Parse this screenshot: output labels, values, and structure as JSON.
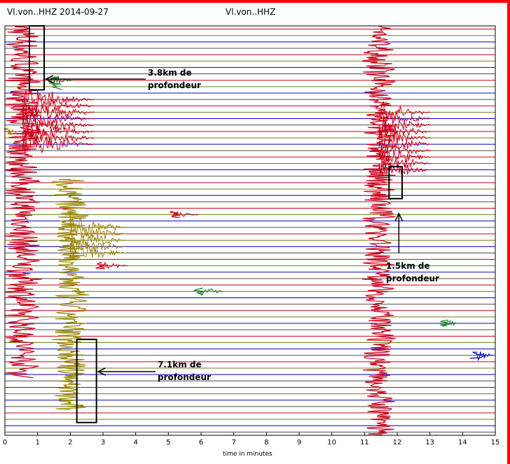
{
  "header": {
    "left_title": "Vl.von..HHZ 2014-09-27",
    "right_title": "Vl.von..HHZ"
  },
  "chart_data": {
    "type": "line",
    "title": "Vl.von..HHZ 2014-09-27",
    "xlabel": "time in minutes",
    "ylabel": "",
    "xlim": [
      0,
      15
    ],
    "x_ticks": [
      0,
      1,
      2,
      3,
      4,
      5,
      6,
      7,
      8,
      9,
      10,
      11,
      12,
      13,
      14,
      15
    ],
    "trace_count": 64,
    "trace_colors": [
      "#c8001a",
      "#6b7d1f",
      "#0000cc",
      "#4d4d4d"
    ],
    "annotations": [
      {
        "text_line1": "3.8km de",
        "text_line2": "profondeur",
        "time_min": 1.0,
        "row": 5
      },
      {
        "text_line1": "7.1km de",
        "text_line2": "profondeur",
        "time_min": 2.5,
        "row": 54
      },
      {
        "text_line1": "1.5km de",
        "text_line2": "profondeur",
        "time_min": 11.95,
        "row": 26
      }
    ],
    "events": [
      {
        "time_min": 0.55,
        "row": 0,
        "length_rows": 55,
        "amplitude": 1.0,
        "color": "#c8001a",
        "coda_min": 2.2
      },
      {
        "time_min": 2.0,
        "row": 24,
        "length_rows": 36,
        "amplitude": 1.0,
        "color": "#9a8a0a",
        "coda_min": 1.7
      },
      {
        "time_min": 11.45,
        "row": 0,
        "length_rows": 64,
        "amplitude": 0.9,
        "color": "#c8001a",
        "coda_min": 1.6
      },
      {
        "time_min": 0.1,
        "row": 16,
        "length_rows": 1,
        "amplitude": 0.25,
        "color": "#9a8a0a",
        "coda_min": 0.3
      },
      {
        "time_min": 1.5,
        "row": 8,
        "length_rows": 2,
        "amplitude": 0.45,
        "color": "#1a7a2a",
        "coda_min": 0.6
      },
      {
        "time_min": 5.15,
        "row": 29,
        "length_rows": 1,
        "amplitude": 0.4,
        "color": "#c8001a",
        "coda_min": 0.8
      },
      {
        "time_min": 2.9,
        "row": 37,
        "length_rows": 1,
        "amplitude": 0.4,
        "color": "#c8001a",
        "coda_min": 0.9
      },
      {
        "time_min": 6.0,
        "row": 41,
        "length_rows": 1,
        "amplitude": 0.4,
        "color": "#1a7a2a",
        "coda_min": 0.7
      },
      {
        "time_min": 13.5,
        "row": 46,
        "length_rows": 1,
        "amplitude": 0.45,
        "color": "#1a7a2a",
        "coda_min": 0.3
      },
      {
        "time_min": 14.45,
        "row": 51,
        "length_rows": 1,
        "amplitude": 0.5,
        "color": "#0000cc",
        "coda_min": 0.5
      }
    ]
  }
}
